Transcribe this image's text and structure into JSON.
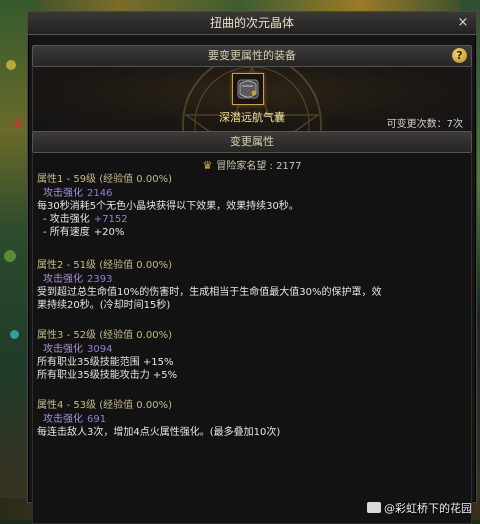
{
  "window": {
    "title": "扭曲的次元晶体",
    "close": "×"
  },
  "equip_section": {
    "header": "要变更属性的装备",
    "help": "?",
    "item_name": "深潜远航气囊",
    "change_count_label": "可变更次数：7次"
  },
  "change_section": {
    "header": "变更属性"
  },
  "reputation": {
    "label": "冒险家名望 : 2177"
  },
  "attributes": [
    {
      "title": "属性1 - 59级 (经验值 0.00%)",
      "atk_label": "攻击强化",
      "atk_value": "2146",
      "desc": "每30秒消耗5个无色小晶块获得以下效果，效果持续30秒。",
      "sub1_label": "- 攻击强化",
      "sub1_value": "+7152",
      "sub2_label": "- 所有速度",
      "sub2_value": "+20%"
    },
    {
      "title": "属性2 - 51级 (经验值 0.00%)",
      "atk_label": "攻击强化",
      "atk_value": "2393",
      "desc1": "受到超过总生命值10%的伤害时，生成相当于生命值最大值30%的保护罩，效",
      "desc2": "果持续20秒。(冷却时间15秒)"
    },
    {
      "title": "属性3 - 52级 (经验值 0.00%)",
      "atk_label": "攻击强化",
      "atk_value": "3094",
      "desc1": "所有职业35级技能范围 +15%",
      "desc2": "所有职业35级技能攻击力 +5%"
    },
    {
      "title": "属性4 - 53级 (经验值 0.00%)",
      "atk_label": "攻击强化",
      "atk_value": "691",
      "desc1": "每连击敌人3次，增加4点火属性强化。(最多叠加10次)"
    }
  ],
  "watermark": "@彩虹桥下的花园"
}
